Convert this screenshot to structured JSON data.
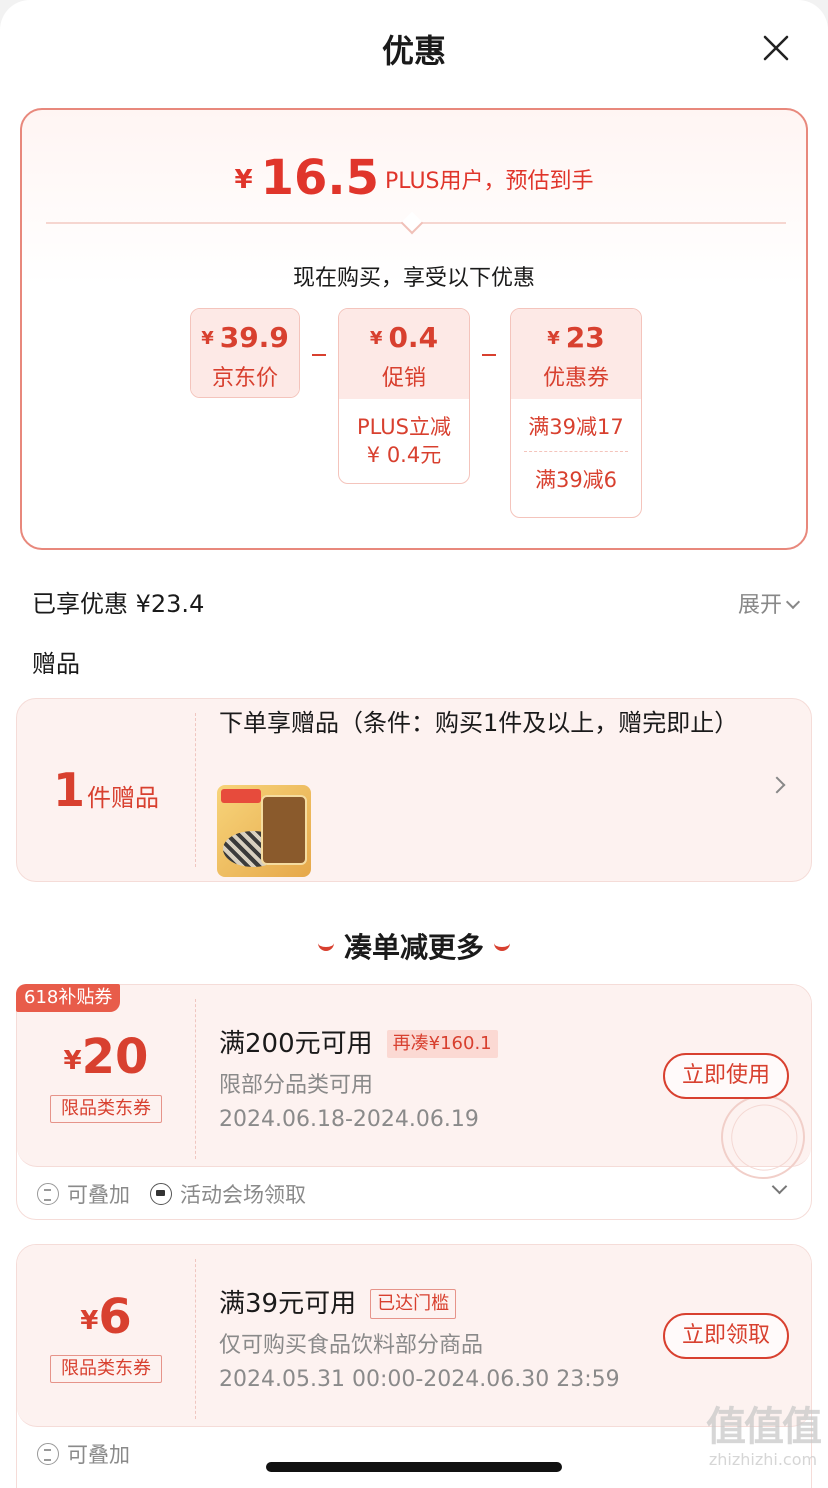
{
  "header": {
    "title": "优惠"
  },
  "summary": {
    "currency": "¥",
    "estimated_price": "16.5",
    "estimated_label": "PLUS用户，预估到手",
    "buy_now_text": "现在购买，享受以下优惠",
    "breakdown": [
      {
        "amount": "39.9",
        "label": "京东价"
      },
      {
        "amount": "0.4",
        "label": "促销",
        "details": [
          "PLUS立减",
          "¥ 0.4元"
        ]
      },
      {
        "amount": "23",
        "label": "优惠券",
        "details": [
          "满39减17",
          "满39减6"
        ]
      }
    ]
  },
  "discounts": {
    "enjoyed": "已享优惠 ¥23.4",
    "expand": "展开"
  },
  "gift": {
    "section_title": "赠品",
    "count": "1",
    "count_label": "件赠品",
    "description": "下单享赠品（条件：购买1件及以上，赠完即止）"
  },
  "more": {
    "title": "凑单减更多"
  },
  "coupons": [
    {
      "tag": "618补贴券",
      "currency": "¥",
      "amount": "20",
      "type": "限品类东券",
      "condition": "满200元可用",
      "badge": "再凑¥160.1",
      "scope": "限部分品类可用",
      "date": "2024.06.18-2024.06.19",
      "button": "立即使用",
      "stackable": "可叠加",
      "source": "活动会场领取"
    },
    {
      "currency": "¥",
      "amount": "6",
      "type": "限品类东券",
      "condition": "满39元可用",
      "badge": "已达门槛",
      "scope": "仅可购买食品饮料部分商品",
      "date": "2024.05.31 00:00-2024.06.30 23:59",
      "button": "立即领取",
      "stackable": "可叠加"
    }
  ],
  "watermark": {
    "logo": "值值值",
    "site": "zhizhizhi.com"
  },
  "colors": {
    "accent": "#d8402f",
    "card_bg": "#fdf2f0",
    "border": "#e8887c"
  },
  "icons": [
    "close-icon",
    "chevron-down-icon",
    "chevron-right-icon",
    "stack-icon",
    "venue-icon",
    "claimed-stamp-icon"
  ]
}
